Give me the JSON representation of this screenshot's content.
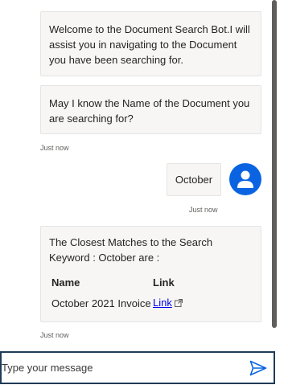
{
  "messages": [
    {
      "text": "Welcome to the Document Search Bot.I will assist you in navigating to the Document you have been searching for."
    },
    {
      "text": "May I know the Name of the Document you are searching for?"
    }
  ],
  "timestamps": [
    "Just now",
    "Just now",
    "Just now"
  ],
  "user_message": {
    "text": "October"
  },
  "result": {
    "title": "The Closest Matches to the Search Keyword : October are :",
    "headers": [
      "Name",
      "Link"
    ],
    "rows": [
      {
        "name": "October 2021 Invoice",
        "link_text": "Link"
      }
    ]
  },
  "composer": {
    "placeholder": "Type your message"
  },
  "icons": {
    "avatar": "person-icon",
    "external": "external-link-icon",
    "send": "send-icon"
  },
  "colors": {
    "avatar_bg": "#0a64e2",
    "bubble_bg": "#f7f6f5",
    "link": "#0000ee",
    "input_border": "#1f3b57"
  }
}
